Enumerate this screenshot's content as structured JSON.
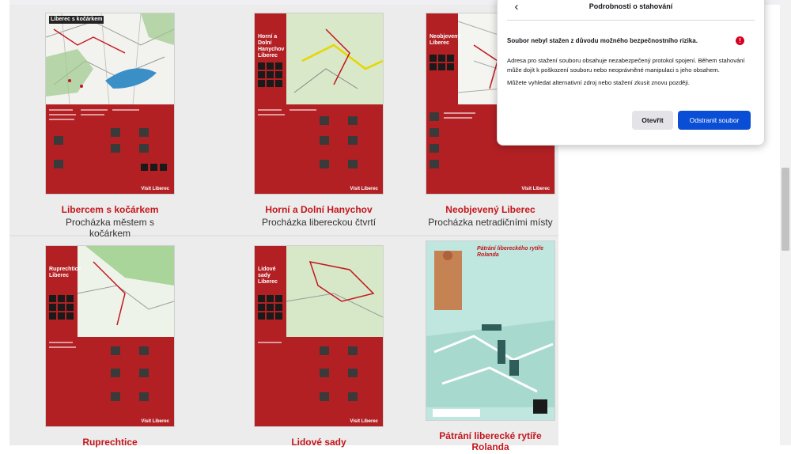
{
  "panel": {
    "title": "Podrobnosti o stahování",
    "warning": "Soubor nebyl stažen z důvodu možného bezpečnostního rizika.",
    "body": [
      "Adresa pro stažení souboru obsahuje nezabezpečený protokol spojení. Během stahování může dojít k poškození souboru nebo neoprávněné manipulaci s jeho obsahem.",
      "Můžete vyhledat alternativní zdroj nebo stažení zkusit znovu později."
    ],
    "open_label": "Otevřít",
    "remove_label": "Odstranit soubor"
  },
  "cards": [
    {
      "title": "Libercem s kočárkem",
      "subtitle": "Procházka městem s kočárkem",
      "poster_heading": "Liberec s kočárkem"
    },
    {
      "title": "Horní a Dolní Hanychov",
      "subtitle": "Procházka libereckou čtvrtí",
      "poster_heading": "Horní a Dolní Hanychov Liberec"
    },
    {
      "title": "Neobjevený Liberec",
      "subtitle": "Procházka netradičními místy",
      "poster_heading": "Neobjevený Liberec"
    },
    {
      "title": "Ruprechtice",
      "subtitle": "",
      "poster_heading": "Ruprechtice Liberec"
    },
    {
      "title": "Lidové sady",
      "subtitle": "",
      "poster_heading": "Lidové sady Liberec"
    },
    {
      "title": "Pátrání liberecké rytíře Rolanda",
      "subtitle": "",
      "poster_heading": "Pátrání libereckého rytíře Rolanda"
    }
  ],
  "poster_footer": "Visit Liberec",
  "colors": {
    "accent_red": "#c4161c",
    "primary_button": "#0b4ed6",
    "warning": "#d70022"
  }
}
